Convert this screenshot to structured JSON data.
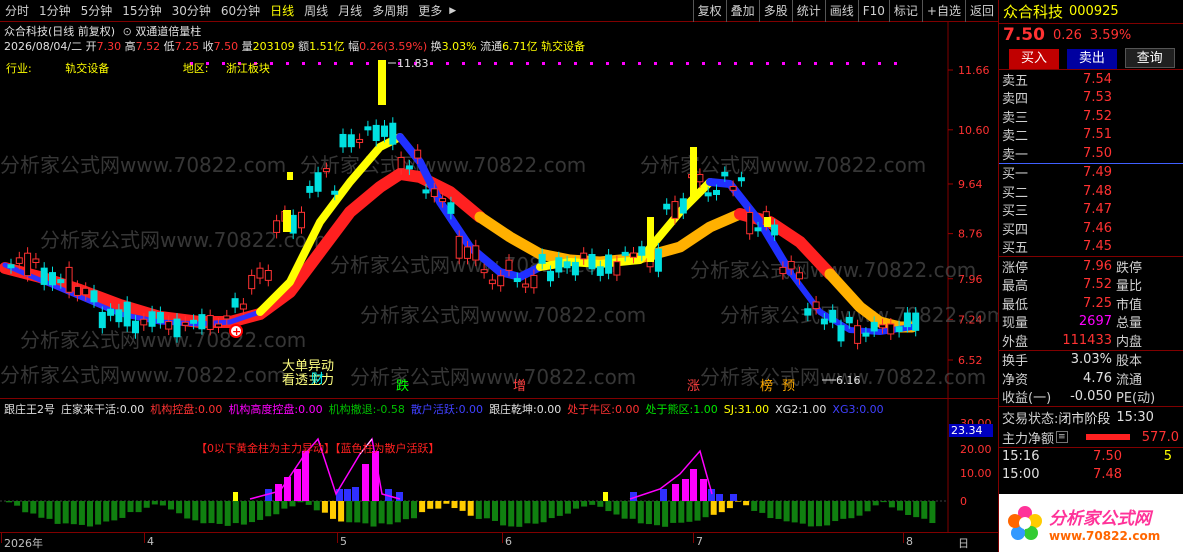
{
  "toolbar": {
    "periods": [
      "分时",
      "1分钟",
      "5分钟",
      "15分钟",
      "30分钟",
      "60分钟",
      "日线",
      "周线",
      "月线",
      "多周期",
      "更多"
    ],
    "active": "日线",
    "more_arrow": "▶",
    "right_buttons": [
      "复权",
      "叠加",
      "多股",
      "统计",
      "画线",
      "F10",
      "标记",
      "+自选",
      "返回"
    ]
  },
  "main": {
    "title": "众合科技(日线 前复权)",
    "indicator_name": "双通道倍量柱",
    "ohlc": {
      "date": "2026/08/04/二",
      "open_label": "开",
      "open": "7.30",
      "high_label": "高",
      "high": "7.52",
      "low_label": "低",
      "low": "7.25",
      "close_label": "收",
      "close": "7.50",
      "vol_label": "量",
      "vol": "203109",
      "amt_label": "额",
      "amt": "1.51亿",
      "chg_label": "幅",
      "chg": "0.26(3.59%)",
      "turn_label": "换",
      "turn": "3.03%",
      "float_label": "流通",
      "float": "6.71亿",
      "sector": "轨交设备"
    },
    "industry_label": "行业:",
    "industry": "轨交设备",
    "region_label": "地区:",
    "region": "浙江板块",
    "y_ticks": [
      "11.66",
      "10.60",
      "9.64",
      "8.76",
      "7.96",
      "7.24",
      "6.52"
    ],
    "high_marker": "11.83",
    "low_marker": "6.16",
    "annotations": [
      "大单异动",
      "看透主力",
      "财",
      "跌",
      "增",
      "涨",
      "榜",
      "预"
    ],
    "watermark": "分析家公式网www.70822.com"
  },
  "indicator": {
    "name": "跟庄王2号",
    "items": [
      {
        "label": "庄家来干活:",
        "value": "0.00",
        "color": "#e0e0e0"
      },
      {
        "label": "机构控盘:",
        "value": "0.00",
        "color": "#ff3232"
      },
      {
        "label": "机构高度控盘:",
        "value": "0.00",
        "color": "#ff00ff"
      },
      {
        "label": "机构撤退:",
        "value": "-0.58",
        "color": "#00c000"
      },
      {
        "label": "散户活跃:",
        "value": "0.00",
        "color": "#4040ff"
      },
      {
        "label": "跟庄乾坤:",
        "value": "0.00",
        "color": "#e0e0e0"
      },
      {
        "label": "处于牛区:",
        "value": "0.00",
        "color": "#ff3232"
      },
      {
        "label": "处于熊区:",
        "value": "1.00",
        "color": "#00e600"
      },
      {
        "label": "SJ:",
        "value": "31.00",
        "color": "#ffff00"
      },
      {
        "label": "XG2:",
        "value": "1.00",
        "color": "#e0e0e0"
      },
      {
        "label": "XG3:",
        "value": "0.00",
        "color": "#4040ff"
      }
    ],
    "note": "【0以下黄金柱为主力异动】【蓝色柱为散户活跃】",
    "y_ticks": [
      "30.00",
      "20.00",
      "10.00",
      "0"
    ],
    "current": "23.34"
  },
  "xaxis": {
    "labels": [
      "2026年",
      "4",
      "5",
      "6",
      "7",
      "8"
    ],
    "tail": "日"
  },
  "panel": {
    "name": "众合科技",
    "code": "000925",
    "price": "7.50",
    "change": "0.26",
    "pct": "3.59%",
    "buy_btn": "买入",
    "sell_btn": "卖出",
    "query_btn": "查询",
    "asks": [
      {
        "label": "卖五",
        "price": "7.54",
        "vol": ""
      },
      {
        "label": "卖四",
        "price": "7.53",
        "vol": ""
      },
      {
        "label": "卖三",
        "price": "7.52",
        "vol": ""
      },
      {
        "label": "卖二",
        "price": "7.51",
        "vol": ""
      },
      {
        "label": "卖一",
        "price": "7.50",
        "vol": ""
      }
    ],
    "bids": [
      {
        "label": "买一",
        "price": "7.49",
        "vol": ""
      },
      {
        "label": "买二",
        "price": "7.48",
        "vol": ""
      },
      {
        "label": "买三",
        "price": "7.47",
        "vol": ""
      },
      {
        "label": "买四",
        "price": "7.46",
        "vol": ""
      },
      {
        "label": "买五",
        "price": "7.45",
        "vol": ""
      }
    ],
    "stats": [
      {
        "l1": "涨停",
        "v1": "7.96",
        "l2": "跌停",
        "c": "red"
      },
      {
        "l1": "最高",
        "v1": "7.52",
        "l2": "量比",
        "c": "red"
      },
      {
        "l1": "最低",
        "v1": "7.25",
        "l2": "市值",
        "c": "red"
      },
      {
        "l1": "现量",
        "v1": "2697",
        "l2": "总量",
        "c": "magenta"
      },
      {
        "l1": "外盘",
        "v1": "111433",
        "l2": "内盘",
        "c": "red"
      }
    ],
    "stats2": [
      {
        "l1": "换手",
        "v1": "3.03%",
        "l2": "股本"
      },
      {
        "l1": "净资",
        "v1": "4.76",
        "l2": "流通"
      },
      {
        "l1": "收益(一)",
        "v1": "-0.050",
        "l2": "PE(动)"
      }
    ],
    "status_label": "交易状态:",
    "status": "闭市阶段",
    "status_time": "15:30",
    "flow_label": "主力净额",
    "flow_value": "577.0",
    "tick_time": "15:16",
    "tick_price": "7.50",
    "tick_vol": "5",
    "tick_time2": "15:00",
    "tick_price2": "7.48",
    "brand_text": "分析家公式网",
    "brand_url": "www.70822.com"
  }
}
